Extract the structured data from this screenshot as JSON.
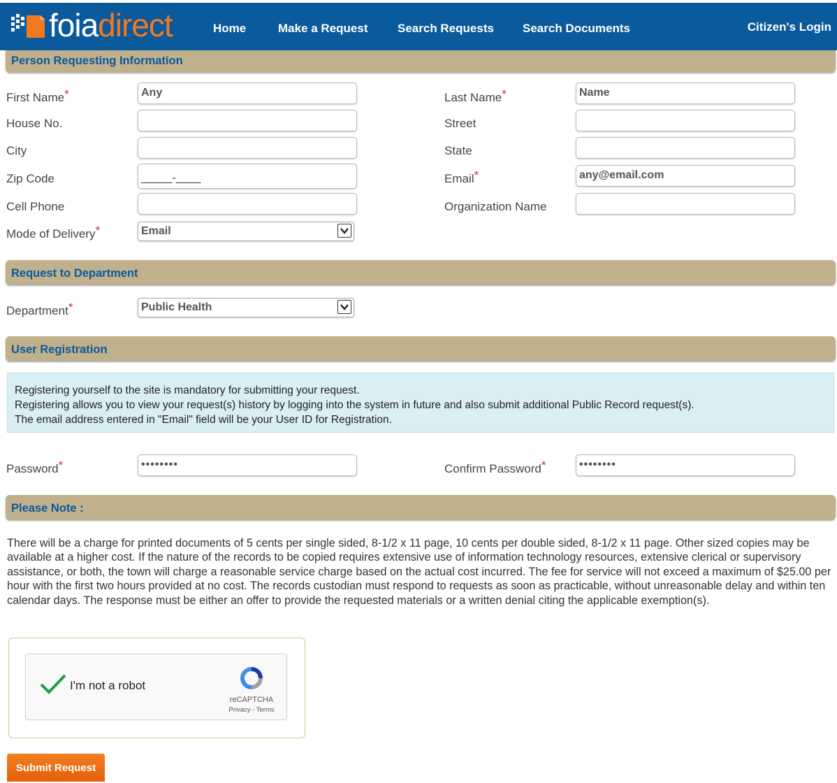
{
  "brand": {
    "logo_white": "foia",
    "logo_orange": "direct"
  },
  "nav": {
    "items": [
      {
        "label": "Home"
      },
      {
        "label": "Make a Request"
      },
      {
        "label": "Search Requests"
      },
      {
        "label": "Search Documents"
      }
    ],
    "login": "Citizen's Login"
  },
  "sections": {
    "person": "Person Requesting Information",
    "department": "Request to Department",
    "registration": "User Registration",
    "note": "Please Note :"
  },
  "required_marker": "*",
  "person": {
    "first_name": {
      "label": "First Name",
      "value": "Any"
    },
    "last_name": {
      "label": "Last Name",
      "value": "Name"
    },
    "house_no": {
      "label": "House No.",
      "value": ""
    },
    "street": {
      "label": "Street",
      "value": ""
    },
    "city": {
      "label": "City",
      "value": ""
    },
    "state": {
      "label": "State",
      "value": ""
    },
    "zip_code": {
      "label": "Zip Code",
      "value": "_____-____"
    },
    "email": {
      "label": "Email",
      "value": "any@email.com"
    },
    "cell_phone": {
      "label": "Cell Phone",
      "value": ""
    },
    "organization": {
      "label": "Organization Name",
      "value": ""
    },
    "delivery": {
      "label": "Mode of Delivery",
      "value": "Email"
    }
  },
  "department": {
    "label": "Department",
    "value": "Public Health"
  },
  "registration": {
    "info": [
      "Registering yourself to the site is mandatory for submitting your request.",
      "Registering allows you to view your request(s) history by logging into the system in future and also submit additional Public Record request(s).",
      "The email address entered in \"Email\" field will be your User ID for Registration."
    ],
    "password": {
      "label": "Password",
      "value": "••••••••"
    },
    "confirm_password": {
      "label": "Confirm Password",
      "value": "••••••••"
    }
  },
  "note_text": "There will be a charge for printed documents of 5 cents per single sided, 8-1/2 x 11 page, 10 cents per double sided, 8-1/2 x 11 page. Other sized copies may be available at a higher cost. If the nature of the records to be copied requires extensive use of information technology resources, extensive clerical or supervisory assistance, or both, the town will charge a reasonable service charge based on the actual cost incurred. The fee for service will not exceed a maximum of $25.00 per hour with the first two hours provided at no cost. The records custodian must respond to requests as soon as practicable, without unreasonable delay and within ten calendar days. The response must be either an offer to provide the requested materials or a written denial citing the applicable exemption(s).",
  "captcha": {
    "label": "I'm not a robot",
    "brand": "reCAPTCHA",
    "links": "Privacy - Terms"
  },
  "submit_label": "Submit Request",
  "colors": {
    "nav": "#0a5a9c",
    "section": "#c0b08b",
    "accent": "#f07a1f",
    "required": "#e02a2a"
  }
}
